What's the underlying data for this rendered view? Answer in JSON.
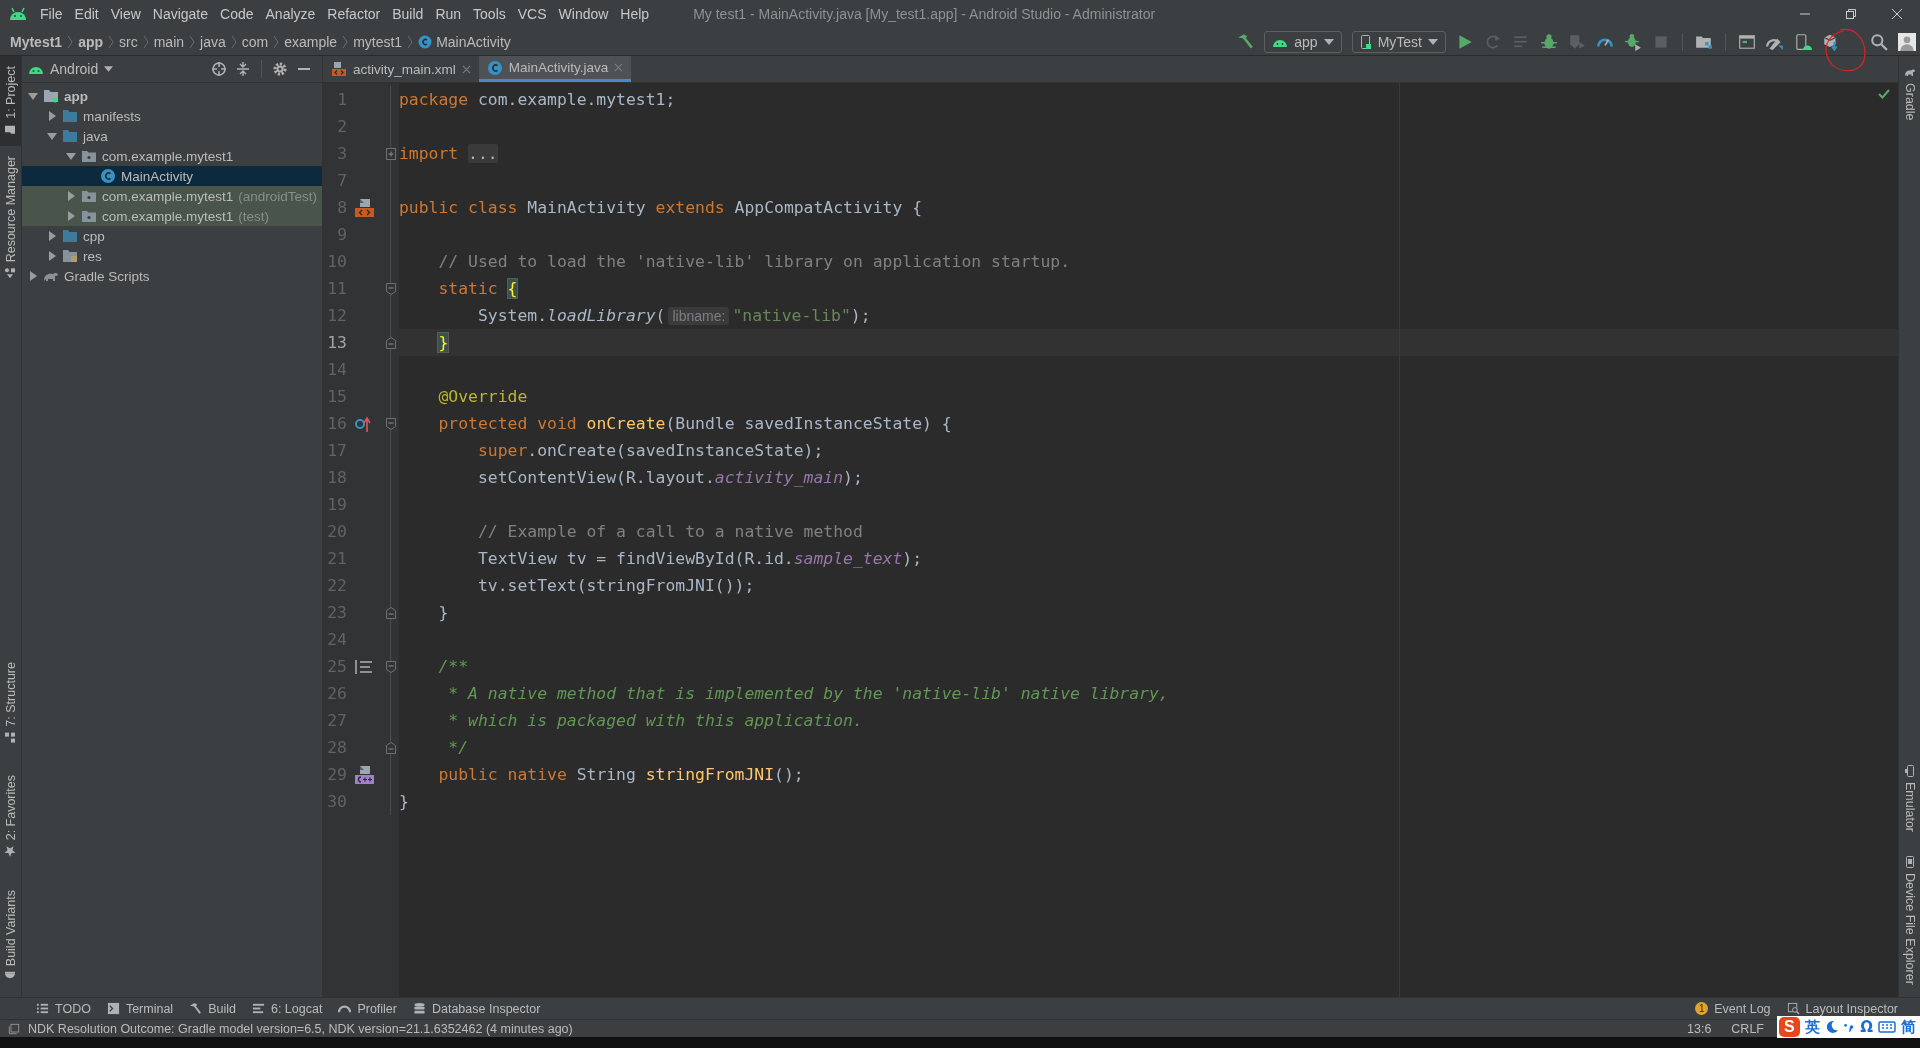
{
  "window": {
    "title": "My test1 - MainActivity.java [My_test1.app] - Android Studio - Administrator"
  },
  "menu": [
    "File",
    "Edit",
    "View",
    "Navigate",
    "Code",
    "Analyze",
    "Refactor",
    "Build",
    "Run",
    "Tools",
    "VCS",
    "Window",
    "Help"
  ],
  "breadcrumb": [
    {
      "label": "Mytest1",
      "kind": "project"
    },
    {
      "label": "app",
      "kind": "module"
    },
    {
      "label": "src",
      "kind": "folder"
    },
    {
      "label": "main",
      "kind": "folder"
    },
    {
      "label": "java",
      "kind": "folder"
    },
    {
      "label": "com",
      "kind": "folder"
    },
    {
      "label": "example",
      "kind": "folder"
    },
    {
      "label": "mytest1",
      "kind": "folder"
    },
    {
      "label": "MainActivity",
      "kind": "class"
    }
  ],
  "toolbar": [
    {
      "kind": "build",
      "disabled": false
    },
    {
      "kind": "config",
      "label": "app"
    },
    {
      "kind": "device",
      "label": "MyTest"
    },
    {
      "kind": "run",
      "disabled": false
    },
    {
      "kind": "rerun",
      "disabled": true
    },
    {
      "kind": "apply-changes",
      "disabled": true
    },
    {
      "kind": "debug",
      "disabled": false
    },
    {
      "kind": "coverage",
      "disabled": true
    },
    {
      "kind": "profile",
      "disabled": false
    },
    {
      "kind": "attach",
      "disabled": false
    },
    {
      "kind": "stop",
      "disabled": true
    },
    {
      "kind": "separator"
    },
    {
      "kind": "structure",
      "disabled": false
    },
    {
      "kind": "separator"
    },
    {
      "kind": "layout",
      "disabled": false
    },
    {
      "kind": "avd",
      "disabled": false
    },
    {
      "kind": "device-manager",
      "disabled": false
    },
    {
      "kind": "sdk",
      "disabled": false
    },
    {
      "kind": "spacer"
    },
    {
      "kind": "search",
      "disabled": false
    },
    {
      "kind": "avatar"
    }
  ],
  "left_strip": {
    "top": [
      {
        "label": "1: Project",
        "kind": "project",
        "selected": true
      },
      {
        "label": "Resource Manager",
        "kind": "resources",
        "selected": false
      }
    ],
    "bottom": [
      {
        "label": "7: Structure",
        "kind": "structure",
        "selected": false
      },
      {
        "label": "2: Favorites",
        "kind": "favorites",
        "selected": false
      },
      {
        "label": "Build Variants",
        "kind": "variants",
        "selected": false
      }
    ]
  },
  "right_strip": {
    "top": [
      {
        "label": "Gradle",
        "kind": "gradle",
        "selected": false
      }
    ],
    "bottom": [
      {
        "label": "Emulator",
        "kind": "emulator",
        "selected": false
      },
      {
        "label": "Device File Explorer",
        "kind": "files",
        "selected": false
      }
    ]
  },
  "project": {
    "view": "Android",
    "tree": [
      {
        "label": "app",
        "kind": "module",
        "expanded": true,
        "selected": false,
        "test_scope": false,
        "children": [
          {
            "label": "manifests",
            "kind": "folder",
            "expanded": false,
            "selected": false,
            "test_scope": false
          },
          {
            "label": "java",
            "kind": "folder",
            "expanded": true,
            "selected": false,
            "test_scope": false,
            "children": [
              {
                "label": "com.example.mytest1",
                "kind": "package",
                "expanded": true,
                "selected": false,
                "test_scope": false,
                "children": [
                  {
                    "label": "MainActivity",
                    "kind": "class",
                    "selected": true,
                    "test_scope": false
                  }
                ]
              },
              {
                "label": "com.example.mytest1",
                "suffix": "(androidTest)",
                "kind": "package",
                "expanded": false,
                "selected": false,
                "test_scope": true
              },
              {
                "label": "com.example.mytest1",
                "suffix": "(test)",
                "kind": "package",
                "expanded": false,
                "selected": false,
                "test_scope": true
              }
            ]
          },
          {
            "label": "cpp",
            "kind": "folder",
            "expanded": false,
            "selected": false,
            "test_scope": false
          },
          {
            "label": "res",
            "kind": "res-folder",
            "expanded": false,
            "selected": false,
            "test_scope": false
          }
        ]
      },
      {
        "label": "Gradle Scripts",
        "kind": "gradle",
        "expanded": false,
        "selected": false,
        "test_scope": false
      }
    ]
  },
  "tabs": [
    {
      "label": "activity_main.xml",
      "kind": "xml",
      "selected": false
    },
    {
      "label": "MainActivity.java",
      "kind": "class",
      "selected": true
    }
  ],
  "code": [
    {
      "number": "1",
      "current": false,
      "tokens": [
        {
          "text": "package",
          "kind": "keyword"
        },
        {
          "text": " com.example.mytest1;",
          "kind": "plain"
        }
      ]
    },
    {
      "number": "2",
      "current": false
    },
    {
      "number": "3",
      "current": false,
      "fold": {
        "kind": "collapsed"
      },
      "tokens": [
        {
          "text": "import ",
          "kind": "keyword"
        },
        {
          "text": "...",
          "kind": "folded"
        }
      ]
    },
    {
      "number": "7",
      "current": false
    },
    {
      "number": "8",
      "current": false,
      "marker": {
        "kind": "layout"
      },
      "tokens": [
        {
          "text": "public class ",
          "kind": "keyword"
        },
        {
          "text": "MainActivity ",
          "kind": "plain"
        },
        {
          "text": "extends ",
          "kind": "keyword"
        },
        {
          "text": "AppCompatActivity {",
          "kind": "plain"
        }
      ]
    },
    {
      "number": "9",
      "current": false
    },
    {
      "number": "10",
      "current": false,
      "tokens": [
        {
          "text": "    // Used to load the 'native-lib' library on application startup.",
          "kind": "comment"
        }
      ]
    },
    {
      "number": "11",
      "current": false,
      "fold": {
        "kind": "start"
      },
      "tokens": [
        {
          "text": "    static ",
          "kind": "keyword"
        },
        {
          "text": "{",
          "kind": "brace-match"
        }
      ]
    },
    {
      "number": "12",
      "current": false,
      "tokens": [
        {
          "text": "        System.",
          "kind": "plain"
        },
        {
          "text": "loadLibrary",
          "kind": "static-call"
        },
        {
          "text": "(",
          "kind": "plain"
        },
        {
          "text": "libname:",
          "kind": "hint"
        },
        {
          "text": "\"native-lib\"",
          "kind": "string"
        },
        {
          "text": ");",
          "kind": "plain"
        }
      ]
    },
    {
      "number": "13",
      "current": true,
      "fold": {
        "kind": "end"
      },
      "tokens": [
        {
          "text": "    }",
          "kind": "brace-match"
        }
      ]
    },
    {
      "number": "14",
      "current": false
    },
    {
      "number": "15",
      "current": false,
      "tokens": [
        {
          "text": "    @Override",
          "kind": "annotation"
        }
      ]
    },
    {
      "number": "16",
      "current": false,
      "marker": {
        "kind": "override"
      },
      "fold": {
        "kind": "start"
      },
      "tokens": [
        {
          "text": "    protected void ",
          "kind": "keyword"
        },
        {
          "text": "onCreate",
          "kind": "method"
        },
        {
          "text": "(Bundle savedInstanceState) {",
          "kind": "plain"
        }
      ]
    },
    {
      "number": "17",
      "current": false,
      "tokens": [
        {
          "text": "        super",
          "kind": "keyword"
        },
        {
          "text": ".onCreate(savedInstanceState);",
          "kind": "plain"
        }
      ]
    },
    {
      "number": "18",
      "current": false,
      "tokens": [
        {
          "text": "        setContentView(R.layout.",
          "kind": "plain"
        },
        {
          "text": "activity_main",
          "kind": "field"
        },
        {
          "text": ");",
          "kind": "plain"
        }
      ]
    },
    {
      "number": "19",
      "current": false
    },
    {
      "number": "20",
      "current": false,
      "tokens": [
        {
          "text": "        // Example of a call to a native method",
          "kind": "comment"
        }
      ]
    },
    {
      "number": "21",
      "current": false,
      "tokens": [
        {
          "text": "        TextView tv = findViewById(R.id.",
          "kind": "plain"
        },
        {
          "text": "sample_text",
          "kind": "field"
        },
        {
          "text": ");",
          "kind": "plain"
        }
      ]
    },
    {
      "number": "22",
      "current": false,
      "tokens": [
        {
          "text": "        tv.setText(stringFromJNI());",
          "kind": "plain"
        }
      ]
    },
    {
      "number": "23",
      "current": false,
      "fold": {
        "kind": "end"
      },
      "tokens": [
        {
          "text": "    }",
          "kind": "plain"
        }
      ]
    },
    {
      "number": "24",
      "current": false
    },
    {
      "number": "25",
      "current": false,
      "marker": {
        "kind": "doc"
      },
      "fold": {
        "kind": "start"
      },
      "tokens": [
        {
          "text": "    /**",
          "kind": "doc"
        }
      ]
    },
    {
      "number": "26",
      "current": false,
      "tokens": [
        {
          "text": "     * A native method that is implemented by the 'native-lib' native library,",
          "kind": "doc"
        }
      ]
    },
    {
      "number": "27",
      "current": false,
      "tokens": [
        {
          "text": "     * which is packaged with this application.",
          "kind": "doc"
        }
      ]
    },
    {
      "number": "28",
      "current": false,
      "fold": {
        "kind": "end"
      },
      "tokens": [
        {
          "text": "     */",
          "kind": "doc"
        }
      ]
    },
    {
      "number": "29",
      "current": false,
      "marker": {
        "kind": "native"
      },
      "tokens": [
        {
          "text": "    public native ",
          "kind": "keyword"
        },
        {
          "text": "String ",
          "kind": "plain"
        },
        {
          "text": "stringFromJNI",
          "kind": "method"
        },
        {
          "text": "();",
          "kind": "plain"
        }
      ]
    },
    {
      "number": "30",
      "current": false,
      "tokens": [
        {
          "text": "}",
          "kind": "plain"
        }
      ]
    }
  ],
  "tool_buttons": {
    "left": [
      {
        "label": "TODO",
        "kind": "todo"
      },
      {
        "label": "Terminal",
        "kind": "terminal"
      },
      {
        "label": "Build",
        "kind": "build"
      },
      {
        "label": "6: Logcat",
        "kind": "logcat"
      },
      {
        "label": "Profiler",
        "kind": "profiler"
      },
      {
        "label": "Database Inspector",
        "kind": "database"
      }
    ],
    "right": [
      {
        "label": "Event Log",
        "kind": "event-log",
        "badge": "1"
      },
      {
        "label": "Layout Inspector",
        "kind": "layout-inspector"
      }
    ]
  },
  "status_bar": {
    "message": "NDK Resolution Outcome: Gradle model version=6.5, NDK version=21.1.6352462 (4 minutes ago)",
    "position": "13:6",
    "line_separator": "CRLF"
  },
  "ime_bar": {
    "logo": "S",
    "items": [
      {
        "kind": "text",
        "label": "英"
      },
      {
        "kind": "moon"
      },
      {
        "kind": "punct"
      },
      {
        "kind": "text",
        "label": "Ω"
      },
      {
        "kind": "keyboard"
      },
      {
        "kind": "text",
        "label": "简"
      }
    ]
  }
}
